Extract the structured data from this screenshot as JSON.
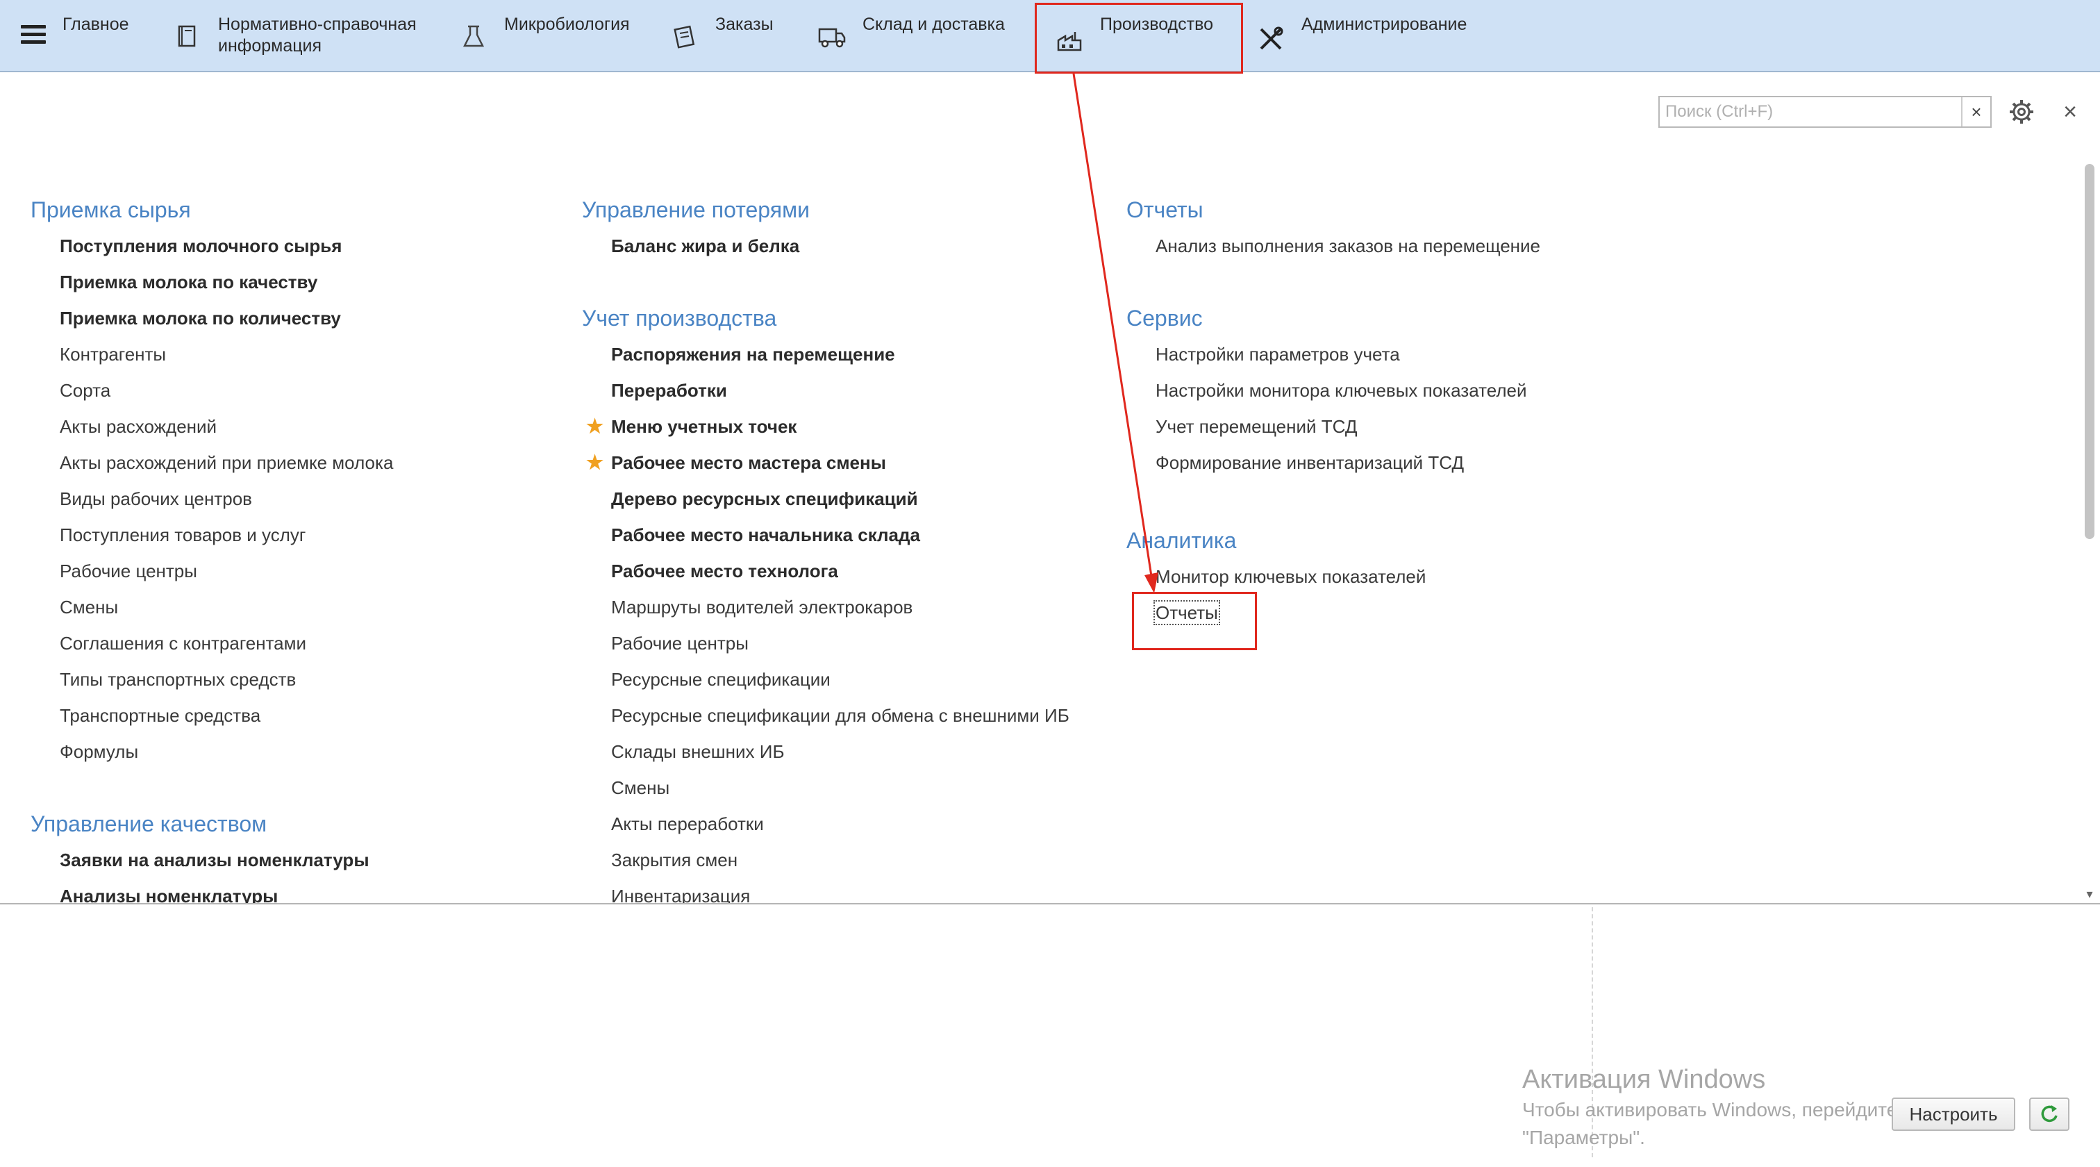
{
  "topbar": {
    "sections": [
      {
        "label": "Главное",
        "icon": "hamburger-menu-icon"
      },
      {
        "label": "Нормативно-справочная информация",
        "icon": "book-icon"
      },
      {
        "label": "Микробиология",
        "icon": "flask-icon"
      },
      {
        "label": "Заказы",
        "icon": "clipboard-icon"
      },
      {
        "label": "Склад и доставка",
        "icon": "truck-icon"
      },
      {
        "label": "Производство",
        "icon": "factory-icon",
        "active": true
      },
      {
        "label": "Администрирование",
        "icon": "tools-icon"
      }
    ]
  },
  "search": {
    "placeholder": "Поиск (Ctrl+F)",
    "value": "",
    "clear_label": "×"
  },
  "window": {
    "close_label": "×"
  },
  "columns": {
    "col1": {
      "groups": [
        {
          "title": "Приемка сырья",
          "items": [
            {
              "label": "Поступления молочного сырья",
              "bold": true
            },
            {
              "label": "Приемка молока по качеству",
              "bold": true
            },
            {
              "label": "Приемка молока по количеству",
              "bold": true
            },
            {
              "label": "Контрагенты"
            },
            {
              "label": "Сорта"
            },
            {
              "label": "Акты расхождений"
            },
            {
              "label": "Акты расхождений при приемке молока"
            },
            {
              "label": "Виды рабочих центров"
            },
            {
              "label": "Поступления товаров и услуг"
            },
            {
              "label": "Рабочие центры"
            },
            {
              "label": "Смены"
            },
            {
              "label": "Соглашения с контрагентами"
            },
            {
              "label": "Типы транспортных средств"
            },
            {
              "label": "Транспортные средства"
            },
            {
              "label": "Формулы"
            }
          ]
        },
        {
          "title": "Управление качеством",
          "items": [
            {
              "label": "Заявки на анализы номенклатуры",
              "bold": true
            },
            {
              "label": "Анализы номенклатуры",
              "bold": true
            }
          ]
        }
      ]
    },
    "col2": {
      "groups": [
        {
          "title": "Управление потерями",
          "items": [
            {
              "label": "Баланс жира и белка",
              "bold": true
            }
          ]
        },
        {
          "title": "Учет производства",
          "items": [
            {
              "label": "Распоряжения на перемещение",
              "bold": true
            },
            {
              "label": "Переработки",
              "bold": true
            },
            {
              "label": "Меню учетных точек",
              "bold": true,
              "starred": true
            },
            {
              "label": "Рабочее место мастера смены",
              "bold": true,
              "starred": true
            },
            {
              "label": "Дерево ресурсных спецификаций",
              "bold": true
            },
            {
              "label": "Рабочее место начальника склада",
              "bold": true
            },
            {
              "label": "Рабочее место технолога",
              "bold": true
            },
            {
              "label": "Маршруты водителей электрокаров"
            },
            {
              "label": "Рабочие центры"
            },
            {
              "label": "Ресурсные спецификации"
            },
            {
              "label": "Ресурсные спецификации для обмена с внешними ИБ"
            },
            {
              "label": "Склады внешних ИБ"
            },
            {
              "label": "Смены"
            },
            {
              "label": "Акты переработки"
            },
            {
              "label": "Закрытия смен"
            },
            {
              "label": "Инвентаризация"
            }
          ]
        }
      ]
    },
    "col3": {
      "groups": [
        {
          "title": "Отчеты",
          "items": [
            {
              "label": "Анализ выполнения заказов на перемещение"
            }
          ]
        },
        {
          "title": "Сервис",
          "items": [
            {
              "label": "Настройки параметров учета"
            },
            {
              "label": "Настройки монитора ключевых показателей"
            },
            {
              "label": "Учет перемещений ТСД"
            },
            {
              "label": "Формирование инвентаризаций ТСД"
            }
          ]
        },
        {
          "title": "Аналитика",
          "items": [
            {
              "label": "Монитор ключевых показателей"
            },
            {
              "label": "Отчеты",
              "focused": true
            }
          ]
        }
      ]
    }
  },
  "activation": {
    "title": "Активация Windows",
    "line1": "Чтобы активировать Windows, перейдите в раздел",
    "line2": "\"Параметры\"."
  },
  "footer": {
    "configure_label": "Настроить"
  },
  "colors": {
    "topbar_bg": "#cfe1f5",
    "group_title": "#4a84c4",
    "annotation_red": "#e0281e",
    "star": "#f0a020"
  }
}
